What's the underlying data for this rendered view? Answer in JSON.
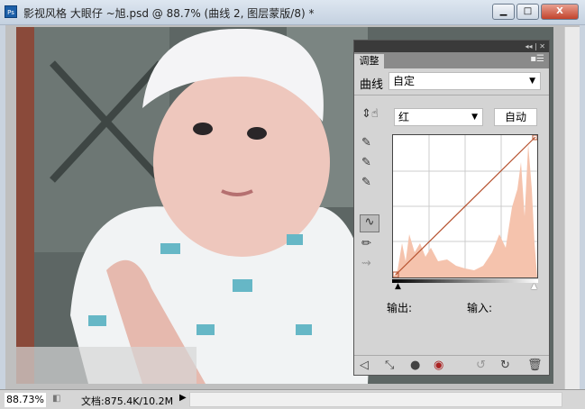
{
  "window": {
    "title": "影视风格 大眼仔 ~旭.psd @ 88.7% (曲线 2, 图层蒙版/8) *",
    "app_icon": "Ps",
    "minimize": "▁",
    "maximize": "□",
    "close": "X"
  },
  "panel": {
    "tab": "调整",
    "header_controls": "◂◂ | ✕",
    "menu": "▪☰",
    "type_label": "曲线",
    "preset": "自定",
    "channel": "红",
    "auto": "自动",
    "output_label": "输出:",
    "input_label": "输入:"
  },
  "status": {
    "zoom": "88.73%",
    "doc": "文档:875.4K/10.2M"
  },
  "colors": {
    "histogram": "#f5c3ad",
    "curve": "#b5502d"
  }
}
